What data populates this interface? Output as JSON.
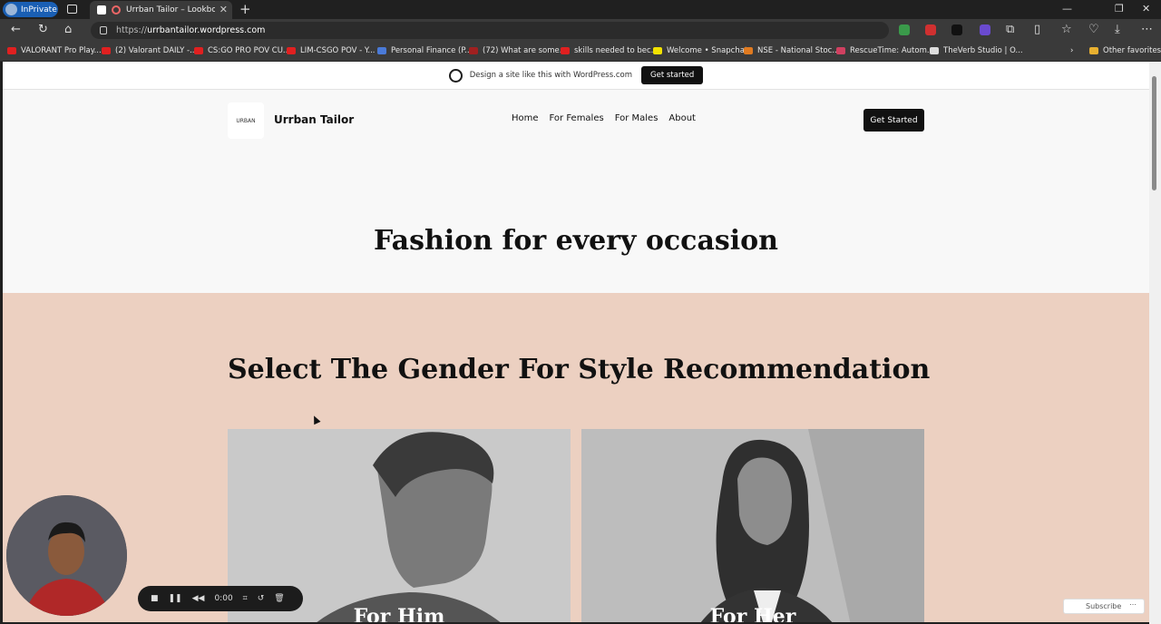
{
  "browser": {
    "inprivate_label": "InPrivate",
    "tab_title": "Urrban Tailor – Lookbook fo",
    "url_prefix": "https://",
    "url_domain": "urrbantailor.wordpress.com",
    "bookmarks": [
      "VALORANT Pro Play...",
      "(2) Valorant DAILY -...",
      "CS:GO PRO POV CU...",
      "LIM-CSGO POV - Y...",
      "Personal Finance (P...",
      "(72) What are some...",
      "skills needed to bec...",
      "Welcome • Snapchat",
      "NSE - National Stoc...",
      "RescueTime: Autom...",
      "TheVerb Studio | O..."
    ],
    "other_favorites": "Other favorites"
  },
  "wpbar": {
    "text": "Design a site like this with WordPress.com",
    "button": "Get started"
  },
  "site": {
    "logo_text": "URBAN",
    "title": "Urrban Tailor",
    "menu": [
      "Home",
      "For Females",
      "For Males",
      "About"
    ],
    "cta": "Get Started",
    "hero_title": "Fashion for every occasion",
    "section_title": "Select The Gender For Style Recommendation",
    "cards": [
      {
        "caption": "For Him"
      },
      {
        "caption": "For Her"
      }
    ]
  },
  "recorder": {
    "time": "0:00"
  },
  "subscribe_label": "Subscribe",
  "colors": {
    "section_bg": "#ecd0c1",
    "accent_dark": "#111111"
  }
}
